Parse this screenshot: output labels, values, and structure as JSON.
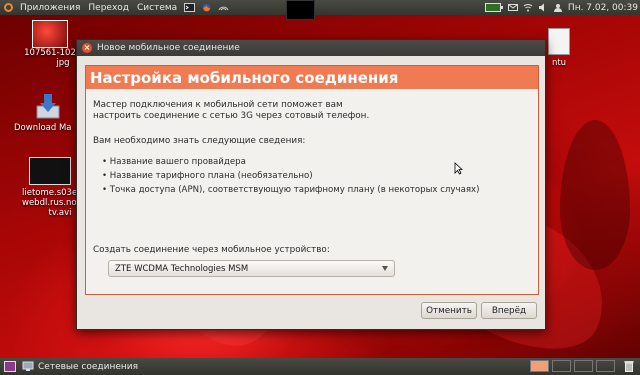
{
  "top_panel": {
    "menus": [
      "Приложения",
      "Переход",
      "Система"
    ],
    "clock": "Пн. 7.02, 00:39"
  },
  "desktop_icons": [
    {
      "label_1": "107561-102",
      "label_2": "jpg"
    },
    {
      "label_1": "Download Ma"
    },
    {
      "label_1": "lietome.s03e",
      "label_2": "webdl.rus.nova",
      "label_3": "tv.avi"
    },
    {
      "label_1": "ntu"
    }
  ],
  "dialog": {
    "window_title": "Новое мобильное соединение",
    "heading": "Настройка мобильного соединения",
    "intro_line_1": "Мастер подключения к мобильной сети поможет вам",
    "intro_line_2": "настроить соединение с сетью 3G через сотовый телефон.",
    "info_label": "Вам необходимо знать следующие сведения:",
    "bullets": [
      "• Название вашего провайдера",
      "• Название тарифного плана (необязательно)",
      "• Точка доступа (APN), соответствующую тарифному плану (в некоторых случаях)"
    ],
    "device_label": "Создать соединение через мобильное устройство:",
    "device_selected": "ZTE WCDMA Technologies MSM",
    "cancel_label": "Отменить",
    "forward_label": "Вперёд"
  },
  "bottom_panel": {
    "task_label": "Сетевые соединения"
  },
  "colors": {
    "accent": "#f07a52",
    "panel": "#3c3b37",
    "dialog_bg": "#e9e6e1"
  }
}
